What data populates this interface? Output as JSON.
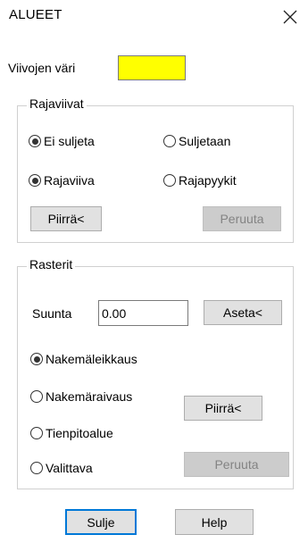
{
  "dialog": {
    "title": "ALUEET",
    "close_icon": "close-icon"
  },
  "line_color": {
    "label": "Viivojen väri",
    "color": "#ffff00"
  },
  "rajaviivat": {
    "group_title": "Rajaviivat",
    "options_row1": [
      {
        "label": "Ei suljeta",
        "selected": true
      },
      {
        "label": "Suljetaan",
        "selected": false
      }
    ],
    "options_row2": [
      {
        "label": "Rajaviiva",
        "selected": true
      },
      {
        "label": "Rajapyykit",
        "selected": false
      }
    ],
    "draw_button": "Piirrä<",
    "cancel_button": "Peruuta"
  },
  "rasterit": {
    "group_title": "Rasterit",
    "direction_label": "Suunta",
    "direction_value": "0.00",
    "set_button": "Aseta<",
    "options": [
      {
        "label": "Nakemäleikkaus",
        "selected": true
      },
      {
        "label": "Nakemäraivaus",
        "selected": false
      },
      {
        "label": "Tienpitoalue",
        "selected": false
      },
      {
        "label": "Valittava",
        "selected": false
      }
    ],
    "draw_button": "Piirrä<",
    "cancel_button": "Peruuta"
  },
  "footer": {
    "close_button": "Sulje",
    "help_button": "Help"
  }
}
